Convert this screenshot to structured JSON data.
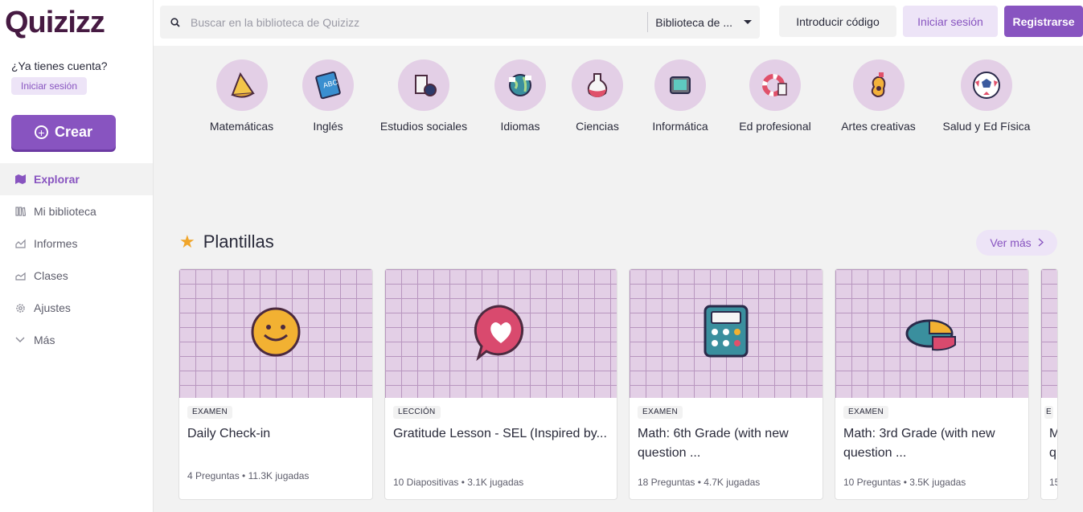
{
  "brand": {
    "name": "Quizizz"
  },
  "sidebar": {
    "have_account": "¿Ya tienes cuenta?",
    "signin_label": "Iniciar sesión",
    "create_label": "Crear",
    "items": [
      {
        "label": "Explorar",
        "icon": "map-icon",
        "active": true
      },
      {
        "label": "Mi biblioteca",
        "icon": "library-icon"
      },
      {
        "label": "Informes",
        "icon": "reports-icon"
      },
      {
        "label": "Clases",
        "icon": "classes-icon"
      },
      {
        "label": "Ajustes",
        "icon": "gear-icon"
      },
      {
        "label": "Más",
        "icon": "chevron-down-icon"
      }
    ]
  },
  "topbar": {
    "search_placeholder": "Buscar en la biblioteca de Quizizz",
    "library_select": "Biblioteca de ...",
    "code_label": "Introducir código",
    "login_label": "Iniciar sesión",
    "register_label": "Registrarse"
  },
  "categories": [
    {
      "label": "Matemáticas",
      "icon": "math-cone-icon"
    },
    {
      "label": "Inglés",
      "icon": "abc-book-icon"
    },
    {
      "label": "Estudios sociales",
      "icon": "scroll-icon"
    },
    {
      "label": "Idiomas",
      "icon": "globe-icon"
    },
    {
      "label": "Ciencias",
      "icon": "flask-icon"
    },
    {
      "label": "Informática",
      "icon": "computer-icon"
    },
    {
      "label": "Ed profesional",
      "icon": "lifebuoy-icon"
    },
    {
      "label": "Artes creativas",
      "icon": "palette-icon"
    },
    {
      "label": "Salud y Ed Física",
      "icon": "soccer-ball-icon"
    }
  ],
  "templates": {
    "title": "Plantillas",
    "see_more": "Ver más",
    "cards": [
      {
        "tag": "EXAMEN",
        "title": "Daily Check-in",
        "meta": "4 Preguntas  •  11.3K jugadas",
        "icon": "smiley-icon"
      },
      {
        "tag": "LECCIÓN",
        "title": "Gratitude Lesson - SEL (Inspired by...",
        "meta": "10 Diapositivas  •  3.1K jugadas",
        "icon": "heart-bubble-icon"
      },
      {
        "tag": "EXAMEN",
        "title": "Math: 6th Grade (with new question ...",
        "meta": "18 Preguntas  •  4.7K jugadas",
        "icon": "calculator-icon"
      },
      {
        "tag": "EXAMEN",
        "title": "Math: 3rd Grade (with new question ...",
        "meta": "10 Preguntas  •  3.5K jugadas",
        "icon": "pie-chart-icon"
      },
      {
        "tag": "E",
        "title": "M q",
        "meta": "15",
        "icon": ""
      }
    ]
  }
}
